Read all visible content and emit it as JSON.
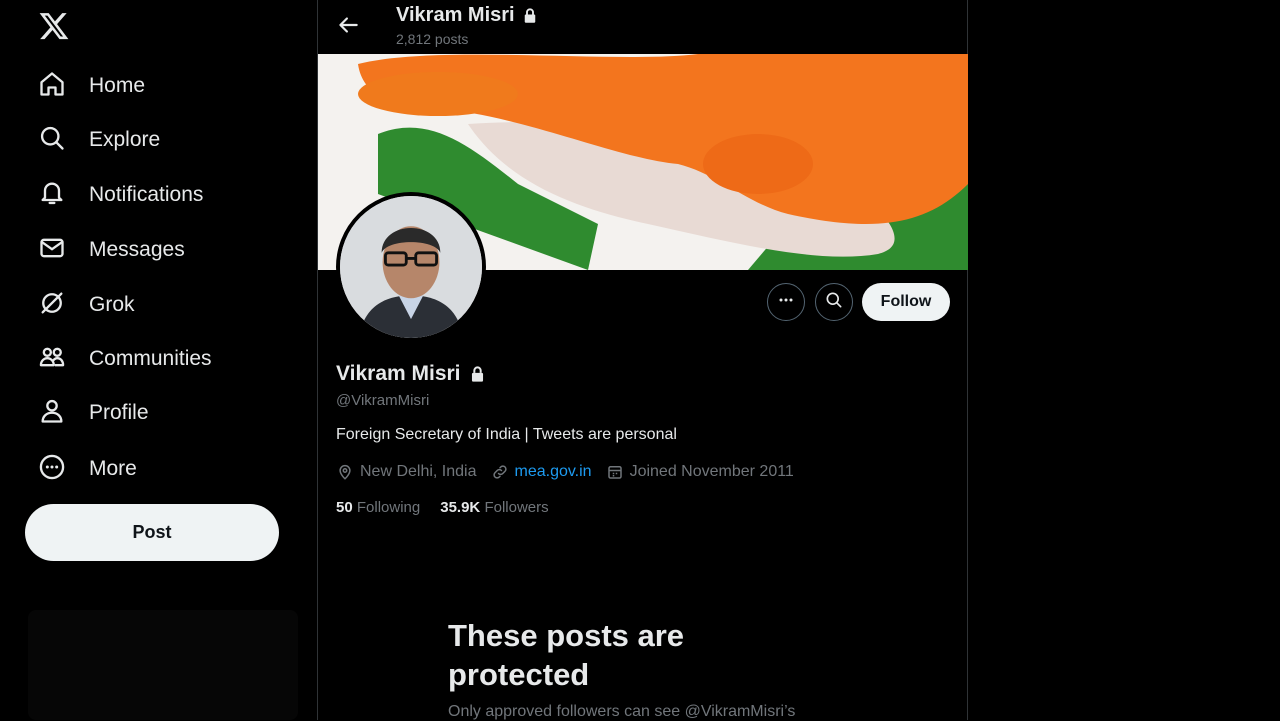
{
  "nav": {
    "logo": "x-logo-icon",
    "items": [
      {
        "label": "Home",
        "icon": "home-icon"
      },
      {
        "label": "Explore",
        "icon": "search-icon"
      },
      {
        "label": "Notifications",
        "icon": "bell-icon"
      },
      {
        "label": "Messages",
        "icon": "envelope-icon"
      },
      {
        "label": "Grok",
        "icon": "grok-icon"
      },
      {
        "label": "Communities",
        "icon": "communities-icon"
      },
      {
        "label": "Profile",
        "icon": "person-icon"
      },
      {
        "label": "More",
        "icon": "more-circle-icon"
      }
    ],
    "post_label": "Post"
  },
  "header": {
    "name": "Vikram Misri",
    "post_count": "2,812 posts"
  },
  "profile": {
    "name": "Vikram Misri",
    "handle": "@VikramMisri",
    "bio": "Foreign Secretary of India | Tweets are personal",
    "location": "New Delhi, India",
    "website": "mea.gov.in",
    "joined": "Joined November 2011",
    "following_count": "50",
    "following_label": "Following",
    "followers_count": "35.9K",
    "followers_label": "Followers",
    "follow_label": "Follow"
  },
  "protected": {
    "title": "These posts are protected",
    "subtitle": "Only approved followers can see @VikramMisri’s"
  },
  "colors": {
    "background": "#000000",
    "text": "#e7e9ea",
    "muted": "#71767b",
    "link": "#1d9bf0",
    "button_bg": "#eff3f4"
  }
}
